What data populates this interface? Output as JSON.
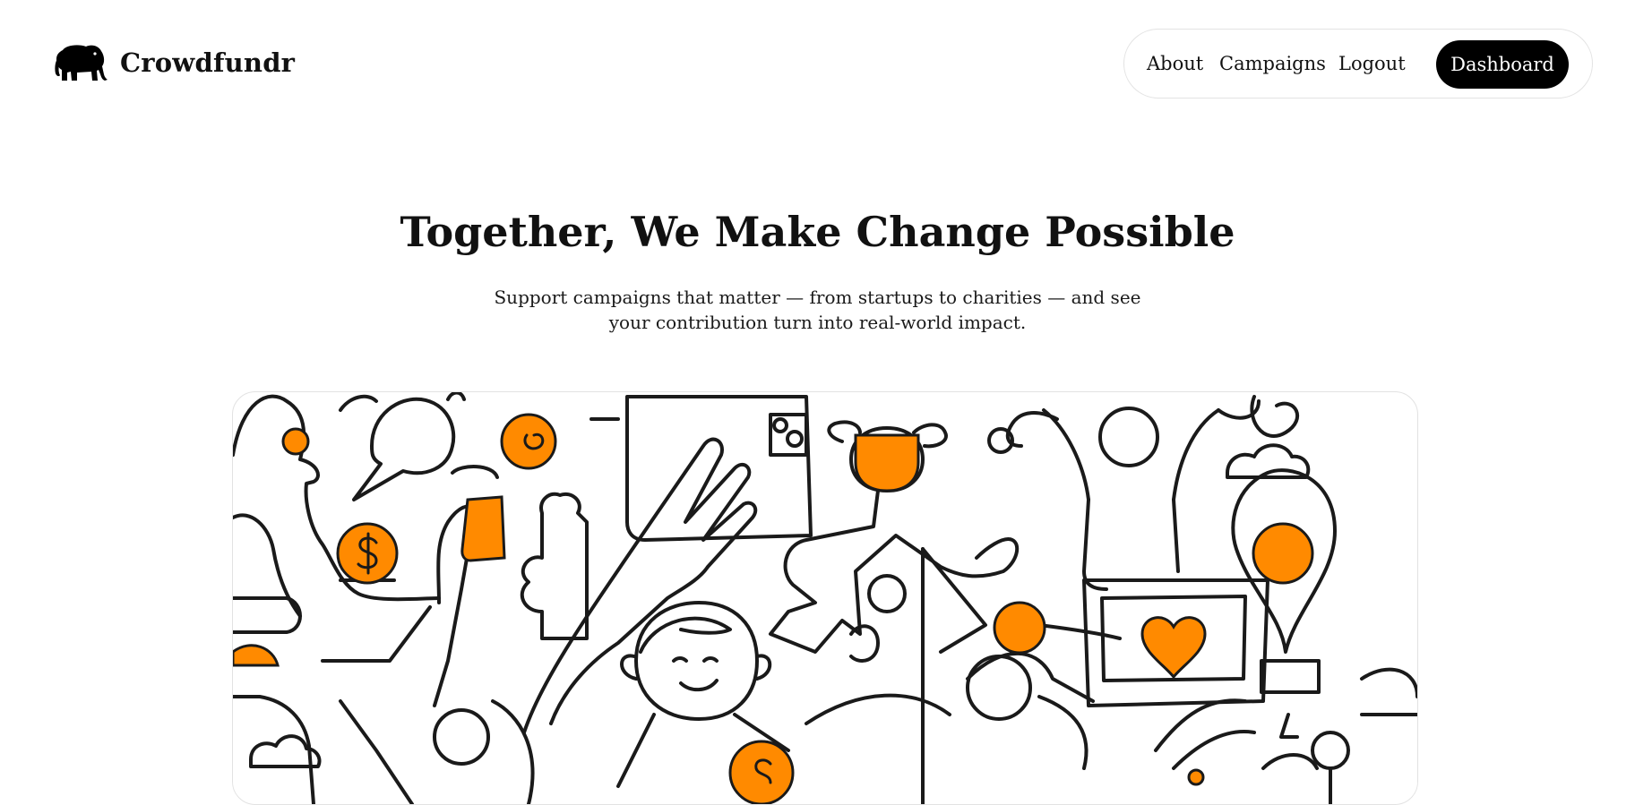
{
  "brand": {
    "name": "Crowdfundr",
    "logo_icon": "elephant-icon"
  },
  "nav": {
    "about": "About",
    "campaigns": "Campaigns",
    "logout": "Logout",
    "dashboard": "Dashboard"
  },
  "hero": {
    "title": "Together, We Make Change Possible",
    "subtitle": "Support campaigns that matter — from startups to charities — and see your contribution turn into real-world impact."
  },
  "colors": {
    "accent": "#FF8A00",
    "ink": "#1A1A1A",
    "button_bg": "#000000"
  }
}
